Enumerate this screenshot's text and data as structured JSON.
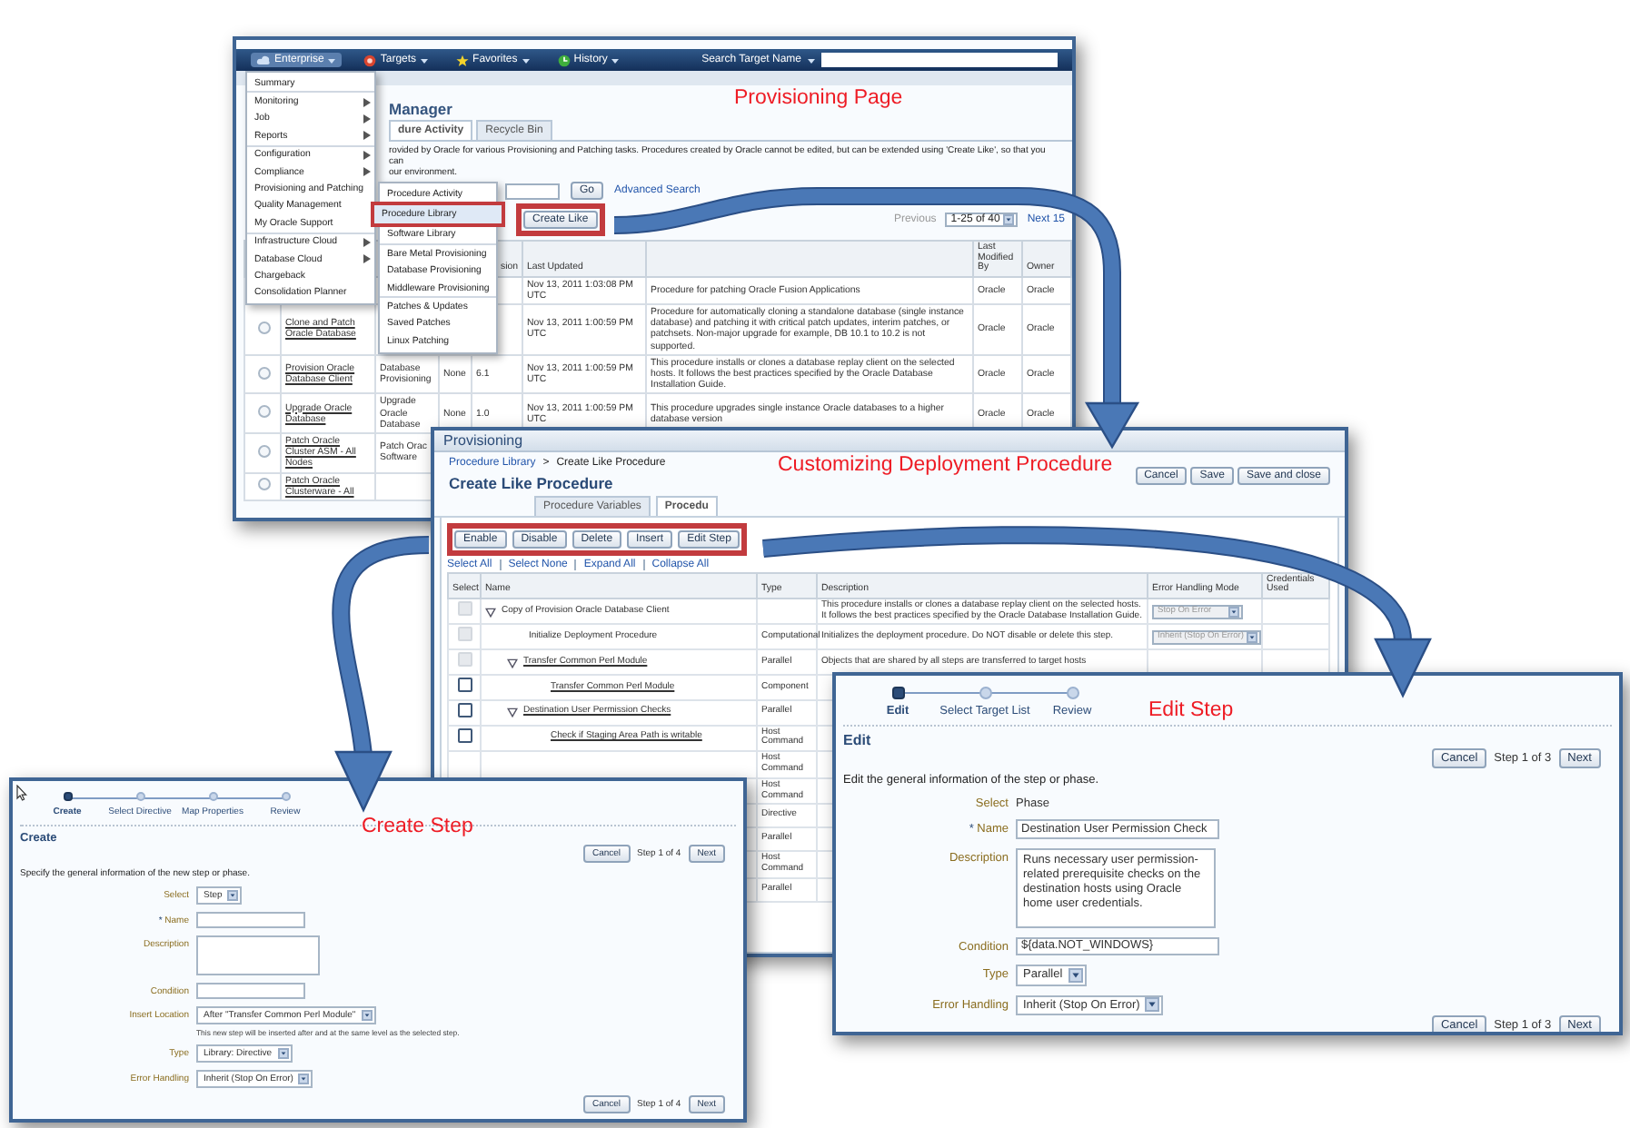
{
  "captions": [
    "Provisioning Page",
    "Customizing Deployment Procedure",
    "Create Step",
    "Edit Step"
  ],
  "provisioning_page": {
    "nav": [
      {
        "label": "Enterprise",
        "selected": true
      },
      {
        "label": "Targets",
        "selected": false
      },
      {
        "label": "Favorites",
        "selected": false
      },
      {
        "label": "History",
        "selected": false
      }
    ],
    "search_label": "Search Target Name",
    "title": "Manager",
    "tabs": [
      {
        "label": "dure Activity",
        "selected": true
      },
      {
        "label": "Recycle Bin",
        "selected": false
      }
    ],
    "intro": [
      "rovided by Oracle for various Provisioning and Patching tasks. Procedures created by Oracle cannot be edited, but can be extended using 'Create Like', so that you can",
      "our environment."
    ],
    "go": "Go",
    "advanced_search": "Advanced Search",
    "action": {
      "label": "Create Like",
      "highlighted": true
    },
    "pager": {
      "previous": "Previous",
      "range": "1-25 of 40",
      "next": "Next 15"
    },
    "columns": {
      "version": "sion",
      "updated": "Last Updated",
      "by": "Last Modified By",
      "owner": "Owner"
    },
    "rows": [
      {
        "updated": "Nov 13, 2011 1:03:08 PM UTC",
        "description": "Procedure for patching Oracle Fusion Applications",
        "by": "Oracle",
        "owner": "Oracle"
      },
      {
        "selected": false,
        "name": "Clone and Patch Oracle Database",
        "updated": "Nov 13, 2011 1:00:59 PM UTC",
        "description": "Procedure for automatically cloning a standalone database (single instance database) and patching it with critical patch updates, interim patches, or patchsets. Non-major upgrade for example, DB 10.1 to 10.2 is not supported.",
        "by": "Oracle",
        "owner": "Oracle"
      },
      {
        "selected": false,
        "name": "Provision Oracle Database Client",
        "type": "Database Provisioning",
        "mode": "None",
        "version": "6.1",
        "updated": "Nov 13, 2011 1:00:59 PM UTC",
        "description": "This procedure installs or clones a database replay client on the selected hosts. It follows the best practices specified by the Oracle Database Installation Guide.",
        "by": "Oracle",
        "owner": "Oracle"
      },
      {
        "selected": false,
        "name": "Upgrade Oracle Database",
        "type": "Upgrade Oracle Database",
        "mode": "None",
        "version": "1.0",
        "updated": "Nov 13, 2011 1:00:59 PM UTC",
        "description": "This procedure upgrades single instance Oracle databases to a higher database version",
        "by": "Oracle",
        "owner": "Oracle"
      },
      {
        "selected": false,
        "name": "Patch Oracle Cluster ASM - All Nodes",
        "type": "Patch Orac Software"
      },
      {
        "selected": false,
        "name": "Patch Oracle Clusterware - All"
      }
    ],
    "menu": [
      [
        {
          "label": "Summary",
          "submenu": false
        }
      ],
      [
        {
          "label": "Monitoring",
          "submenu": true
        },
        {
          "label": "Job",
          "submenu": true
        },
        {
          "label": "Reports",
          "submenu": true
        }
      ],
      [
        {
          "label": "Configuration",
          "submenu": true
        },
        {
          "label": "Compliance",
          "submenu": true
        },
        {
          "label": "Provisioning and Patching",
          "submenu": false
        },
        {
          "label": "Quality Management",
          "submenu": false
        },
        {
          "label": "My Oracle Support",
          "submenu": false
        }
      ],
      [
        {
          "label": "Infrastructure Cloud",
          "submenu": true
        },
        {
          "label": "Database Cloud",
          "submenu": true
        },
        {
          "label": "Chargeback",
          "submenu": false
        },
        {
          "label": "Consolidation Planner",
          "submenu": false
        }
      ]
    ],
    "submenu": [
      [
        {
          "label": "Procedure Activity",
          "highlighted": false
        },
        {
          "label": "Procedure Library",
          "highlighted": true
        },
        {
          "label": "Software Library",
          "highlighted": false
        }
      ],
      [
        {
          "label": "Bare Metal Provisioning",
          "highlighted": false
        },
        {
          "label": "Database Provisioning",
          "highlighted": false
        },
        {
          "label": "Middleware Provisioning",
          "highlighted": false
        }
      ],
      [
        {
          "label": "Patches & Updates",
          "highlighted": false
        },
        {
          "label": "Saved Patches",
          "highlighted": false
        },
        {
          "label": "Linux Patching",
          "highlighted": false
        }
      ]
    ]
  },
  "create_like": {
    "header": "Provisioning",
    "breadcrumb": [
      "Procedure Library",
      "Create Like Procedure"
    ],
    "breadcrumb_separator": ">",
    "title": "Create Like Procedure",
    "buttons": [
      "Cancel",
      "Save",
      "Save and close"
    ],
    "tabs": [
      {
        "label": "Procedure Variables",
        "selected": false
      },
      {
        "label": "Procedu",
        "selected": true
      }
    ],
    "toolbar": {
      "highlighted": true,
      "buttons": [
        "Enable",
        "Disable",
        "Delete",
        "Insert",
        "Edit Step"
      ]
    },
    "links": [
      "Select All",
      "Select None",
      "Expand All",
      "Collapse All"
    ],
    "columns": [
      "Select",
      "Name",
      "Type",
      "Description",
      "Error Handling Mode",
      "Credentials Used"
    ],
    "steps": [
      {
        "name": "Copy of Provision Oracle Database Client",
        "link": false,
        "expanded": true,
        "checked": false,
        "disabled": true,
        "description": "This procedure installs or clones a database replay client on the selected hosts. It follows the best practices specified by the Oracle Database Installation Guide.",
        "error_mode": "Stop On Error",
        "children": [
          {
            "name": "Initialize Deployment Procedure",
            "link": false,
            "checked": false,
            "disabled": true,
            "type": "Computational",
            "description": "Initializes the deployment procedure. Do NOT disable or delete this step.",
            "error_mode": "Inherit (Stop On Error)"
          },
          {
            "name": "Transfer Common Perl Module",
            "link": true,
            "expanded": true,
            "checked": false,
            "disabled": true,
            "type": "Parallel",
            "description": "Objects that are shared by all steps are transferred to target hosts",
            "children": [
              {
                "name": "Transfer Common Perl Module",
                "link": true,
                "checked": false,
                "disabled": false,
                "type": "Component"
              }
            ]
          },
          {
            "name": "Destination User Permission Checks",
            "link": true,
            "expanded": true,
            "checked": false,
            "disabled": false,
            "type": "Parallel",
            "children": [
              {
                "name": "Check if Staging Area Path is writable",
                "link": true,
                "checked": false,
                "disabled": false,
                "type": "Host Command"
              },
              {
                "type": "Host Command"
              },
              {
                "type": "Host Command"
              },
              {
                "type": "Directive"
              },
              {
                "type": "Parallel"
              },
              {
                "type": "Host Command"
              },
              {
                "type": "Parallel"
              }
            ]
          }
        ]
      }
    ]
  },
  "create_step": {
    "train": [
      {
        "label": "Create",
        "selected": true
      },
      {
        "label": "Select Directive",
        "selected": false
      },
      {
        "label": "Map Properties",
        "selected": false
      },
      {
        "label": "Review",
        "selected": false
      }
    ],
    "heading": "Create",
    "top_nav": {
      "cancel": "Cancel",
      "step": "Step 1 of 4",
      "next": "Next"
    },
    "instructions": "Specify the general information of the new step or phase.",
    "fields": [
      {
        "kind": "select",
        "label": "Select",
        "value": "Step"
      },
      {
        "kind": "text",
        "label": "Name",
        "required_mark": "*"
      },
      {
        "kind": "textarea",
        "label": "Description"
      },
      {
        "kind": "text",
        "label": "Condition"
      },
      {
        "kind": "select",
        "label": "Insert Location",
        "value": "After \"Transfer Common Perl Module\"",
        "hint": "This new step will be inserted after and at the same level as the selected step."
      },
      {
        "kind": "select",
        "label": "Type",
        "value": "Library: Directive"
      },
      {
        "kind": "select",
        "label": "Error Handling",
        "value": "Inherit (Stop On Error)"
      }
    ],
    "bottom_nav": {
      "cancel": "Cancel",
      "step": "Step 1 of 4",
      "next": "Next"
    }
  },
  "edit_step": {
    "train": [
      {
        "label": "Edit",
        "selected": true
      },
      {
        "label": "Select Target List",
        "selected": false
      },
      {
        "label": "Review",
        "selected": false
      }
    ],
    "heading": "Edit",
    "top_nav": {
      "cancel": "Cancel",
      "step": "Step 1 of 3",
      "next": "Next"
    },
    "instructions": "Edit the general information of the step or phase.",
    "fields": [
      {
        "kind": "static",
        "label": "Select",
        "value": "Phase"
      },
      {
        "kind": "text",
        "label": "Name",
        "required_mark": "*",
        "value": "Destination User Permission Check"
      },
      {
        "kind": "textarea",
        "label": "Description",
        "value": "Runs necessary user permission-related prerequisite checks on the destination hosts using Oracle home user credentials."
      },
      {
        "kind": "text",
        "label": "Condition",
        "value": "${data.NOT_WINDOWS}"
      },
      {
        "kind": "select",
        "label": "Type",
        "value": "Parallel"
      },
      {
        "kind": "select",
        "label": "Error Handling",
        "value": "Inherit (Stop On Error)"
      }
    ],
    "bottom_nav": {
      "cancel": "Cancel",
      "step": "Step 1 of 3",
      "next": "Next"
    }
  }
}
